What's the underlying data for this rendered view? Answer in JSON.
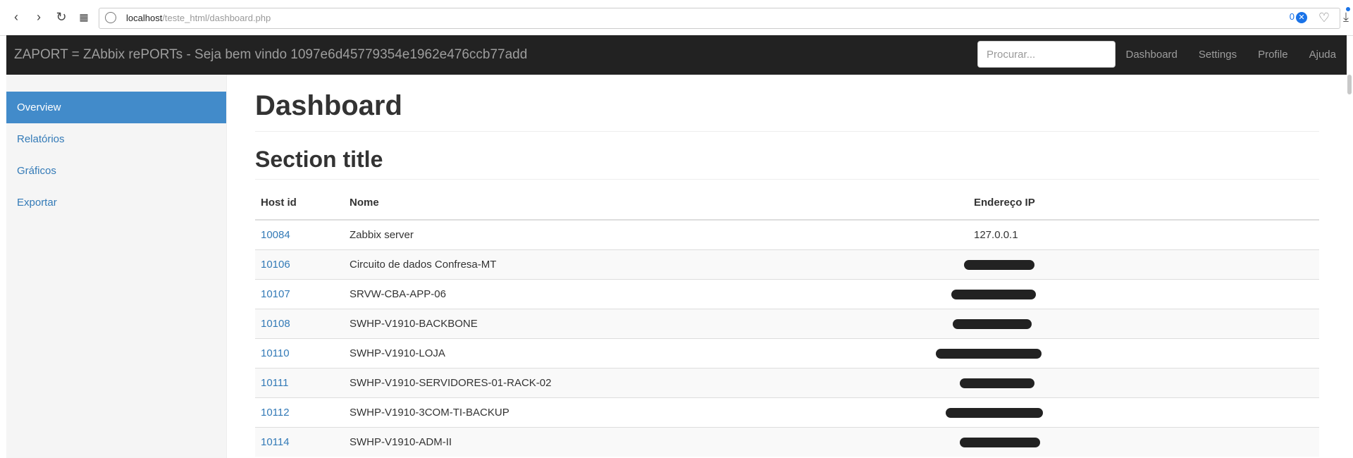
{
  "browser": {
    "url_host": "localhost",
    "url_path": "/teste_html/dashboard.php",
    "badge_count": "0"
  },
  "navbar": {
    "brand": "ZAPORT = ZAbbix rePORTs - Seja bem vindo 1097e6d45779354e1962e476ccb77add",
    "search_placeholder": "Procurar...",
    "links": [
      "Dashboard",
      "Settings",
      "Profile",
      "Ajuda"
    ]
  },
  "sidebar": {
    "items": [
      {
        "label": "Overview",
        "active": true
      },
      {
        "label": "Relatórios"
      },
      {
        "label": "Gráficos"
      },
      {
        "label": "Exportar"
      }
    ]
  },
  "main": {
    "page_title": "Dashboard",
    "section_title": "Section title",
    "table": {
      "headers": [
        "Host id",
        "Nome",
        "Endereço IP"
      ],
      "rows": [
        {
          "id": "10084",
          "name": "Zabbix server",
          "ip": "127.0.0.1"
        },
        {
          "id": "10106",
          "name": "Circuito de dados Confresa-MT",
          "ip": ""
        },
        {
          "id": "10107",
          "name": "SRVW-CBA-APP-06",
          "ip": ""
        },
        {
          "id": "10108",
          "name": "SWHP-V1910-BACKBONE",
          "ip": ""
        },
        {
          "id": "10110",
          "name": "SWHP-V1910-LOJA",
          "ip": ""
        },
        {
          "id": "10111",
          "name": "SWHP-V1910-SERVIDORES-01-RACK-02",
          "ip": ""
        },
        {
          "id": "10112",
          "name": "SWHP-V1910-3COM-TI-BACKUP",
          "ip": ""
        },
        {
          "id": "10114",
          "name": "SWHP-V1910-ADM-II",
          "ip": ""
        }
      ]
    }
  },
  "colors": {
    "navbar_bg": "#222222",
    "sidebar_active": "#428bca",
    "link": "#337ab7"
  }
}
